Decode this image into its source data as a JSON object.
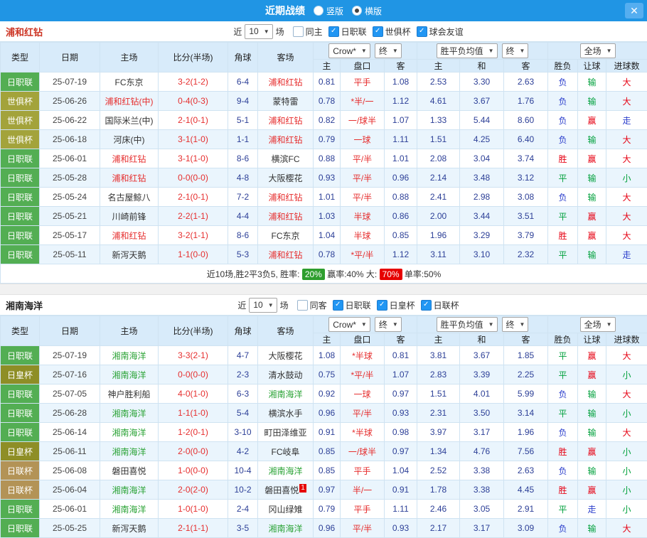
{
  "titlebar": {
    "title": "近期战绩",
    "radios": [
      {
        "label": "竖版",
        "selected": false
      },
      {
        "label": "横版",
        "selected": true
      }
    ],
    "close_label": "✕"
  },
  "table_header": {
    "type": "类型",
    "date": "日期",
    "home": "主场",
    "score": "比分(半场)",
    "corner": "角球",
    "away": "客场",
    "asia_dropdown": "Crow*",
    "asia_final": "终",
    "europe_dropdown": "胜平负均值",
    "europe_final": "终",
    "scope_dropdown": "全场",
    "asia_home": "主",
    "asia_pan": "盘口",
    "asia_away": "客",
    "eu_win": "主",
    "eu_draw": "和",
    "eu_lose": "客",
    "result": "胜负",
    "handicap": "让球",
    "goals": "进球数"
  },
  "colors": {
    "league": {
      "日职联": "#53ae53",
      "世俱杯": "#a3a33b",
      "日皇杯": "#8e8e26",
      "日联杯": "#b39356"
    },
    "result": {
      "胜": "#e60012",
      "平": "#00a03c",
      "负": "#2b3ecc"
    },
    "handicap_result": {
      "赢": "#e60012",
      "输": "#00a03c",
      "走": "#2b3ecc"
    },
    "goal_result": {
      "大": "#e60012",
      "小": "#00a03c",
      "走": "#2b3ecc"
    },
    "checkbox_checked": "#2196f3",
    "titlebar_blue": "#2095e4"
  },
  "sections": [
    {
      "team": "浦和红钻",
      "highlight": "#e62e2e",
      "filter": {
        "near": "近",
        "count": "10",
        "unit": "场",
        "checkboxes": [
          {
            "label": "同主",
            "checked": false
          },
          {
            "label": "日职联",
            "checked": true
          },
          {
            "label": "世俱杯",
            "checked": true
          },
          {
            "label": "球会友谊",
            "checked": true
          }
        ]
      },
      "rows": [
        {
          "lt": "日职联",
          "date": "25-07-19",
          "home": "FC东京",
          "hHl": false,
          "score": "3-2(1-2)",
          "corner": "6-4",
          "away": "浦和红钻",
          "aHl": true,
          "h": "0.81",
          "pan": "平手",
          "a": "1.08",
          "w": "2.53",
          "d": "3.30",
          "l": "2.63",
          "res": "负",
          "ball": "输",
          "goal": "大"
        },
        {
          "lt": "世俱杯",
          "date": "25-06-26",
          "home": "浦和红钻(中)",
          "hHl": true,
          "score": "0-4(0-3)",
          "corner": "9-4",
          "away": "蒙特雷",
          "aHl": false,
          "h": "0.78",
          "pan": "*半/一",
          "a": "1.12",
          "w": "4.61",
          "d": "3.67",
          "l": "1.76",
          "res": "负",
          "ball": "输",
          "goal": "大"
        },
        {
          "lt": "世俱杯",
          "date": "25-06-22",
          "home": "国际米兰(中)",
          "hHl": false,
          "score": "2-1(0-1)",
          "corner": "5-1",
          "away": "浦和红钻",
          "aHl": true,
          "h": "0.82",
          "pan": "一/球半",
          "a": "1.07",
          "w": "1.33",
          "d": "5.44",
          "l": "8.60",
          "res": "负",
          "ball": "赢",
          "goal": "走"
        },
        {
          "lt": "世俱杯",
          "date": "25-06-18",
          "home": "河床(中)",
          "hHl": false,
          "score": "3-1(1-0)",
          "corner": "1-1",
          "away": "浦和红钻",
          "aHl": true,
          "h": "0.79",
          "pan": "一球",
          "a": "1.11",
          "w": "1.51",
          "d": "4.25",
          "l": "6.40",
          "res": "负",
          "ball": "输",
          "goal": "大"
        },
        {
          "lt": "日职联",
          "date": "25-06-01",
          "home": "浦和红钻",
          "hHl": true,
          "score": "3-1(1-0)",
          "corner": "8-6",
          "away": "横滨FC",
          "aHl": false,
          "h": "0.88",
          "pan": "平/半",
          "a": "1.01",
          "w": "2.08",
          "d": "3.04",
          "l": "3.74",
          "res": "胜",
          "ball": "赢",
          "goal": "大"
        },
        {
          "lt": "日职联",
          "date": "25-05-28",
          "home": "浦和红钻",
          "hHl": true,
          "score": "0-0(0-0)",
          "corner": "4-8",
          "away": "大阪樱花",
          "aHl": false,
          "h": "0.93",
          "pan": "平/半",
          "a": "0.96",
          "w": "2.14",
          "d": "3.48",
          "l": "3.12",
          "res": "平",
          "ball": "输",
          "goal": "小"
        },
        {
          "lt": "日职联",
          "date": "25-05-24",
          "home": "名古屋鲸八",
          "hHl": false,
          "score": "2-1(0-1)",
          "corner": "7-2",
          "away": "浦和红钻",
          "aHl": true,
          "h": "1.01",
          "pan": "平/半",
          "a": "0.88",
          "w": "2.41",
          "d": "2.98",
          "l": "3.08",
          "res": "负",
          "ball": "输",
          "goal": "大"
        },
        {
          "lt": "日职联",
          "date": "25-05-21",
          "home": "川崎前锋",
          "hHl": false,
          "score": "2-2(1-1)",
          "corner": "4-4",
          "away": "浦和红钻",
          "aHl": true,
          "h": "1.03",
          "pan": "半球",
          "a": "0.86",
          "w": "2.00",
          "d": "3.44",
          "l": "3.51",
          "res": "平",
          "ball": "赢",
          "goal": "大"
        },
        {
          "lt": "日职联",
          "date": "25-05-17",
          "home": "浦和红钻",
          "hHl": true,
          "score": "3-2(1-1)",
          "corner": "8-6",
          "away": "FC东京",
          "aHl": false,
          "h": "1.04",
          "pan": "半球",
          "a": "0.85",
          "w": "1.96",
          "d": "3.29",
          "l": "3.79",
          "res": "胜",
          "ball": "赢",
          "goal": "大"
        },
        {
          "lt": "日职联",
          "date": "25-05-11",
          "home": "新泻天鹅",
          "hHl": false,
          "score": "1-1(0-0)",
          "corner": "5-3",
          "away": "浦和红钻",
          "aHl": true,
          "h": "0.78",
          "pan": "*平/半",
          "a": "1.12",
          "w": "3.11",
          "d": "3.10",
          "l": "2.32",
          "res": "平",
          "ball": "输",
          "goal": "走"
        }
      ],
      "summary": {
        "prefix": "近10场,胜2平3负5, 胜率: ",
        "win_rate": "20%",
        "mid": " 赢率:40%  大: ",
        "big_rate": "70%",
        "suffix": " 单率:50%"
      }
    },
    {
      "team": "湘南海洋",
      "highlight": "#2ba336",
      "filter": {
        "near": "近",
        "count": "10",
        "unit": "场",
        "checkboxes": [
          {
            "label": "同客",
            "checked": false
          },
          {
            "label": "日职联",
            "checked": true
          },
          {
            "label": "日皇杯",
            "checked": true
          },
          {
            "label": "日联杯",
            "checked": true
          }
        ]
      },
      "rows": [
        {
          "lt": "日职联",
          "date": "25-07-19",
          "home": "湘南海洋",
          "hHl": true,
          "score": "3-3(2-1)",
          "corner": "4-7",
          "away": "大阪樱花",
          "aHl": false,
          "h": "1.08",
          "pan": "*半球",
          "a": "0.81",
          "w": "3.81",
          "d": "3.67",
          "l": "1.85",
          "res": "平",
          "ball": "赢",
          "goal": "大"
        },
        {
          "lt": "日皇杯",
          "date": "25-07-16",
          "home": "湘南海洋",
          "hHl": true,
          "score": "0-0(0-0)",
          "corner": "2-3",
          "away": "清水鼓动",
          "aHl": false,
          "h": "0.75",
          "pan": "*平/半",
          "a": "1.07",
          "w": "2.83",
          "d": "3.39",
          "l": "2.25",
          "res": "平",
          "ball": "赢",
          "goal": "小"
        },
        {
          "lt": "日职联",
          "date": "25-07-05",
          "home": "神户胜利船",
          "hHl": false,
          "score": "4-0(1-0)",
          "corner": "6-3",
          "away": "湘南海洋",
          "aHl": true,
          "h": "0.92",
          "pan": "一球",
          "a": "0.97",
          "w": "1.51",
          "d": "4.01",
          "l": "5.99",
          "res": "负",
          "ball": "输",
          "goal": "大"
        },
        {
          "lt": "日职联",
          "date": "25-06-28",
          "home": "湘南海洋",
          "hHl": true,
          "score": "1-1(1-0)",
          "corner": "5-4",
          "away": "横滨水手",
          "aHl": false,
          "h": "0.96",
          "pan": "平/半",
          "a": "0.93",
          "w": "2.31",
          "d": "3.50",
          "l": "3.14",
          "res": "平",
          "ball": "输",
          "goal": "小"
        },
        {
          "lt": "日职联",
          "date": "25-06-14",
          "home": "湘南海洋",
          "hHl": true,
          "score": "1-2(0-1)",
          "corner": "3-10",
          "away": "町田泽维亚",
          "aHl": false,
          "h": "0.91",
          "pan": "*半球",
          "a": "0.98",
          "w": "3.97",
          "d": "3.17",
          "l": "1.96",
          "res": "负",
          "ball": "输",
          "goal": "大"
        },
        {
          "lt": "日皇杯",
          "date": "25-06-11",
          "home": "湘南海洋",
          "hHl": true,
          "score": "2-0(0-0)",
          "corner": "4-2",
          "away": "FC岐阜",
          "aHl": false,
          "h": "0.85",
          "pan": "一/球半",
          "a": "0.97",
          "w": "1.34",
          "d": "4.76",
          "l": "7.56",
          "res": "胜",
          "ball": "赢",
          "goal": "小"
        },
        {
          "lt": "日联杯",
          "date": "25-06-08",
          "home": "磐田喜悦",
          "hHl": false,
          "score": "1-0(0-0)",
          "corner": "10-4",
          "away": "湘南海洋",
          "aHl": true,
          "h": "0.85",
          "pan": "平手",
          "a": "1.04",
          "w": "2.52",
          "d": "3.38",
          "l": "2.63",
          "res": "负",
          "ball": "输",
          "goal": "小"
        },
        {
          "lt": "日联杯",
          "date": "25-06-04",
          "home": "湘南海洋",
          "hHl": true,
          "score": "2-0(2-0)",
          "corner": "10-2",
          "away": "磐田喜悦",
          "aHl": false,
          "badge": "1",
          "h": "0.97",
          "pan": "半/一",
          "a": "0.91",
          "w": "1.78",
          "d": "3.38",
          "l": "4.45",
          "res": "胜",
          "ball": "赢",
          "goal": "小"
        },
        {
          "lt": "日职联",
          "date": "25-06-01",
          "home": "湘南海洋",
          "hHl": true,
          "score": "1-0(1-0)",
          "corner": "2-4",
          "away": "冈山绿雉",
          "aHl": false,
          "h": "0.79",
          "pan": "平手",
          "a": "1.11",
          "w": "2.46",
          "d": "3.05",
          "l": "2.91",
          "res": "平",
          "ball": "走",
          "goal": "小"
        },
        {
          "lt": "日职联",
          "date": "25-05-25",
          "home": "新泻天鹅",
          "hHl": false,
          "score": "2-1(1-1)",
          "corner": "3-5",
          "away": "湘南海洋",
          "aHl": true,
          "h": "0.96",
          "pan": "平/半",
          "a": "0.93",
          "w": "2.17",
          "d": "3.17",
          "l": "3.09",
          "res": "负",
          "ball": "输",
          "goal": "大"
        }
      ]
    }
  ]
}
